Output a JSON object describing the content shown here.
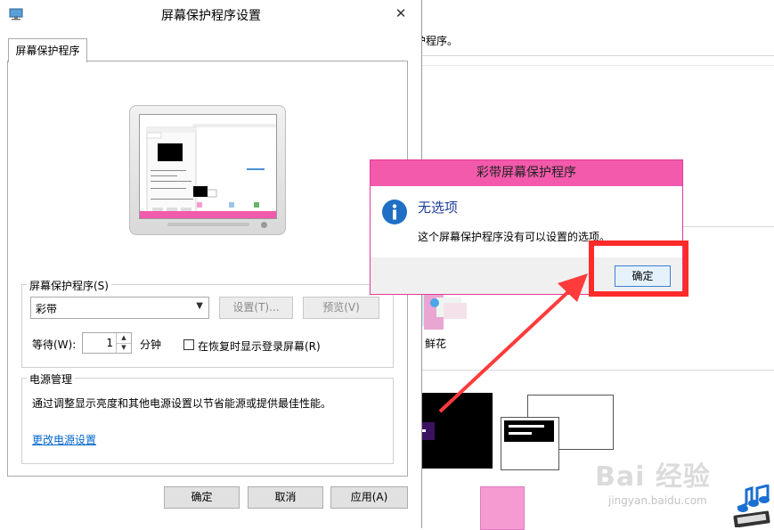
{
  "background_window": {
    "description_text": "护程序。",
    "flower_label": "鲜花"
  },
  "screensaver_dialog": {
    "title": "屏幕保护程序设置",
    "close_symbol": "✕",
    "tab_label": "屏幕保护程序",
    "screensaver_group_label": "屏幕保护程序(S)",
    "selected_screensaver": "彩带",
    "settings_button": "设置(T)...",
    "preview_button": "预览(V)",
    "wait_label": "等待(W):",
    "wait_value": "1",
    "wait_unit": "分钟",
    "logon_checkbox_label": "在恢复时显示登录屏幕(R)",
    "logon_checkbox_checked": false,
    "power_group_label": "电源管理",
    "power_description": "通过调整显示亮度和其他电源设置以节省能源或提供最佳性能。",
    "power_link": "更改电源设置",
    "ok_button": "确定",
    "cancel_button": "取消",
    "apply_button": "应用(A)"
  },
  "message_box": {
    "title": "彩带屏幕保护程序",
    "heading": "无选项",
    "message": "这个屏幕保护程序没有可以设置的选项。",
    "ok_button": "确定",
    "title_color": "#f35aab",
    "icon": "info-icon"
  },
  "annotation": {
    "highlight_color": "#ff2b2b"
  },
  "watermark": {
    "text": "Bai 经验",
    "subtext": "jingyan.baidu.com"
  }
}
